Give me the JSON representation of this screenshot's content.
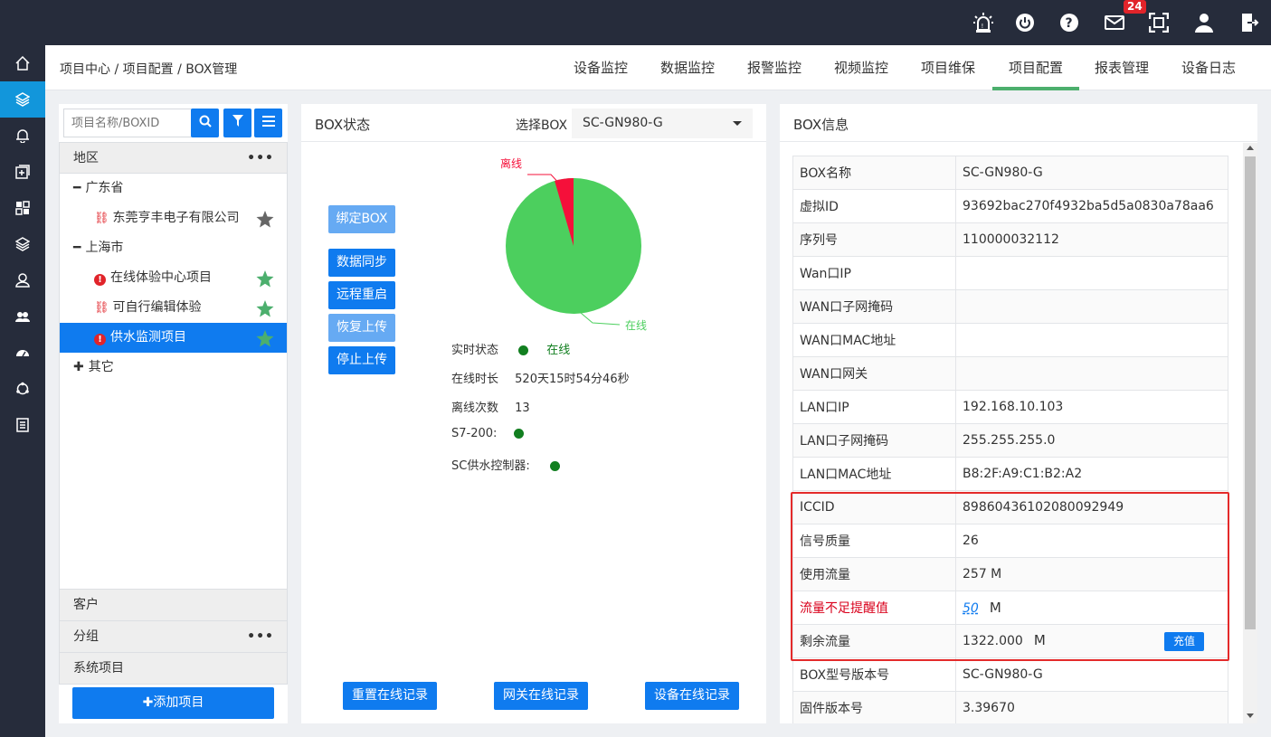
{
  "topbar": {
    "notifications_badge": "24",
    "icons": [
      "alarm-light-icon",
      "power-icon",
      "help-icon",
      "mail-icon",
      "fullscreen-icon",
      "user-icon",
      "logout-icon"
    ]
  },
  "sidebar": {
    "items": [
      "home-icon",
      "layers-icon",
      "bell-icon",
      "add-box-icon",
      "dashboard-icon",
      "stack-icon",
      "user-outline-icon",
      "group-icon",
      "gauge-icon",
      "cycle-icon",
      "list-icon"
    ],
    "active_index": 1
  },
  "breadcrumb": "项目中心 / 项目配置 / BOX管理",
  "tabs": [
    "设备监控",
    "数据监控",
    "报警监控",
    "视频监控",
    "项目维保",
    "项目配置",
    "报表管理",
    "设备日志"
  ],
  "active_tab": "项目配置",
  "left": {
    "search_placeholder": "项目名称/BOXID",
    "region_title": "地区",
    "tree": {
      "guangdong": "广东省",
      "dongguan": "东莞亨丰电子有限公司",
      "shanghai": "上海市",
      "online_center": "在线体验中心项目",
      "editable": "可自行编辑体验",
      "water": "供水监测项目",
      "other": "其它"
    },
    "customer": "客户",
    "group": "分组",
    "system": "系统项目",
    "add_button": "✚添加项目"
  },
  "mid": {
    "title": "BOX状态",
    "select_label": "选择BOX",
    "selected_box": "SC-GN980-G",
    "buttons": {
      "bind": "绑定BOX",
      "sync": "数据同步",
      "reboot": "远程重启",
      "resume": "恢复上传",
      "stop": "停止上传"
    },
    "pie": {
      "offline_label": "离线",
      "online_label": "在线",
      "offline_fraction": 0.045
    },
    "status_label": "实时状态",
    "status_value": "在线",
    "online_duration_label": "在线时长",
    "online_duration_value": "520天15时54分46秒",
    "offline_count_label": "离线次数",
    "offline_count_value": "13",
    "s7_label": "S7-200:",
    "sc_label": "SC供水控制器:",
    "reset_online": "重置在线记录",
    "gateway_online": "网关在线记录",
    "device_online": "设备在线记录"
  },
  "right": {
    "title": "BOX信息",
    "rows": [
      {
        "k": "BOX名称",
        "v": "SC-GN980-G"
      },
      {
        "k": "虚拟ID",
        "v": "93692bac270f4932ba5d5a0830a78aa6"
      },
      {
        "k": "序列号",
        "v": "110000032112"
      },
      {
        "k": "Wan口IP",
        "v": ""
      },
      {
        "k": "WAN口子网掩码",
        "v": ""
      },
      {
        "k": "WAN口MAC地址",
        "v": ""
      },
      {
        "k": "WAN口网关",
        "v": ""
      },
      {
        "k": "LAN口IP",
        "v": "192.168.10.103"
      },
      {
        "k": "LAN口子网掩码",
        "v": "255.255.255.0"
      },
      {
        "k": "LAN口MAC地址",
        "v": "B8:2F:A9:C1:B2:A2"
      },
      {
        "k": "ICCID",
        "v": "89860436102080092949"
      },
      {
        "k": "信号质量",
        "v": "26"
      },
      {
        "k": "使用流量",
        "v": "257 M"
      },
      {
        "k": "流量不足提醒值",
        "v": "50",
        "unit": "M"
      },
      {
        "k": "剩余流量",
        "v": "1322.000",
        "unit": "M",
        "button": "充值"
      },
      {
        "k": "BOX型号版本号",
        "v": "SC-GN980-G"
      },
      {
        "k": "固件版本号",
        "v": "3.39670"
      }
    ]
  }
}
